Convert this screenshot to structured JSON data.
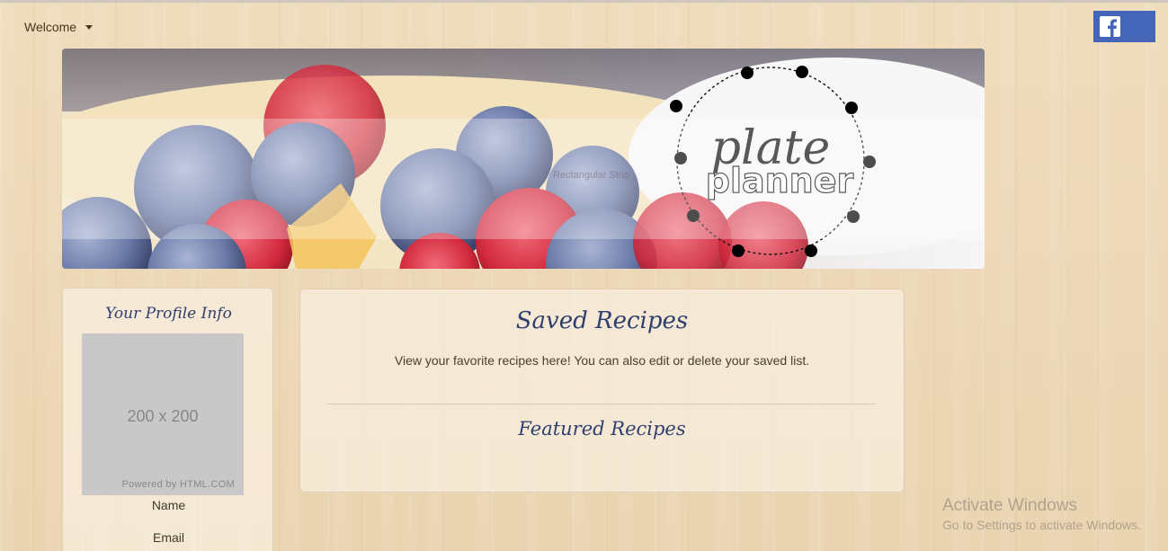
{
  "header": {
    "welcome_label": "Welcome",
    "facebook_icon": "facebook-icon"
  },
  "hero": {
    "logo_top_text": "plate",
    "logo_bottom_text": "planner",
    "strip_label": "Rectangular Strip"
  },
  "profile": {
    "title": "Your Profile Info",
    "image_dimensions": "200 x 200",
    "image_credit": "Powered by HTML.COM",
    "fields": [
      "Name",
      "Email"
    ]
  },
  "recipes": {
    "title": "Saved Recipes",
    "description": "View your favorite recipes here! You can also edit or delete your saved list.",
    "featured_title": "Featured Recipes"
  },
  "watermark": {
    "line1": "Activate Windows",
    "line2": "Go to Settings to activate Windows."
  },
  "colors": {
    "accent_blue": "#2f3f6f",
    "facebook_blue": "#4566b8",
    "background_wood": "#ecd8b8"
  }
}
